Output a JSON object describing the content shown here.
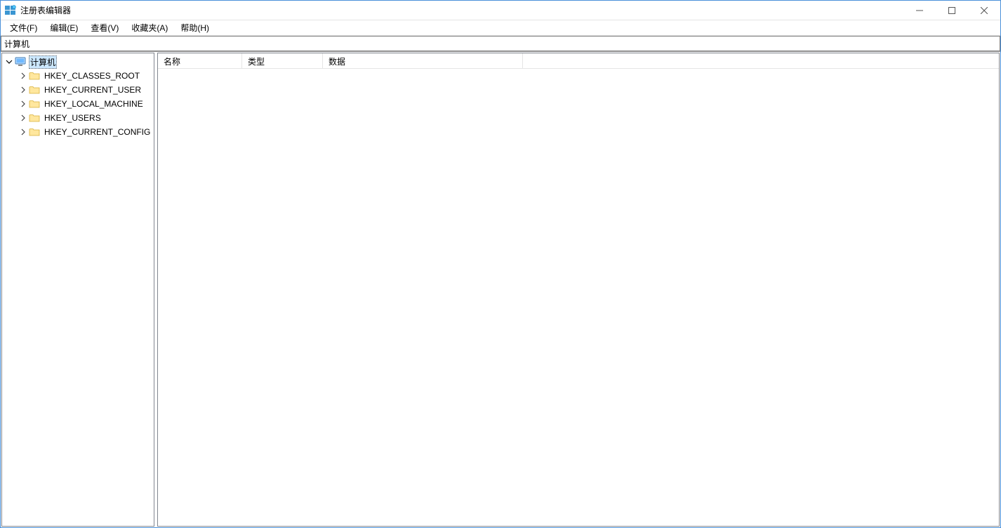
{
  "window": {
    "title": "注册表编辑器"
  },
  "menu": {
    "file": "文件(F)",
    "edit": "编辑(E)",
    "view": "查看(V)",
    "favorites": "收藏夹(A)",
    "help": "帮助(H)"
  },
  "addressbar": {
    "path": "计算机"
  },
  "tree": {
    "root": "计算机",
    "hives": [
      "HKEY_CLASSES_ROOT",
      "HKEY_CURRENT_USER",
      "HKEY_LOCAL_MACHINE",
      "HKEY_USERS",
      "HKEY_CURRENT_CONFIG"
    ]
  },
  "columns": {
    "name": "名称",
    "type": "类型",
    "data": "数据"
  }
}
